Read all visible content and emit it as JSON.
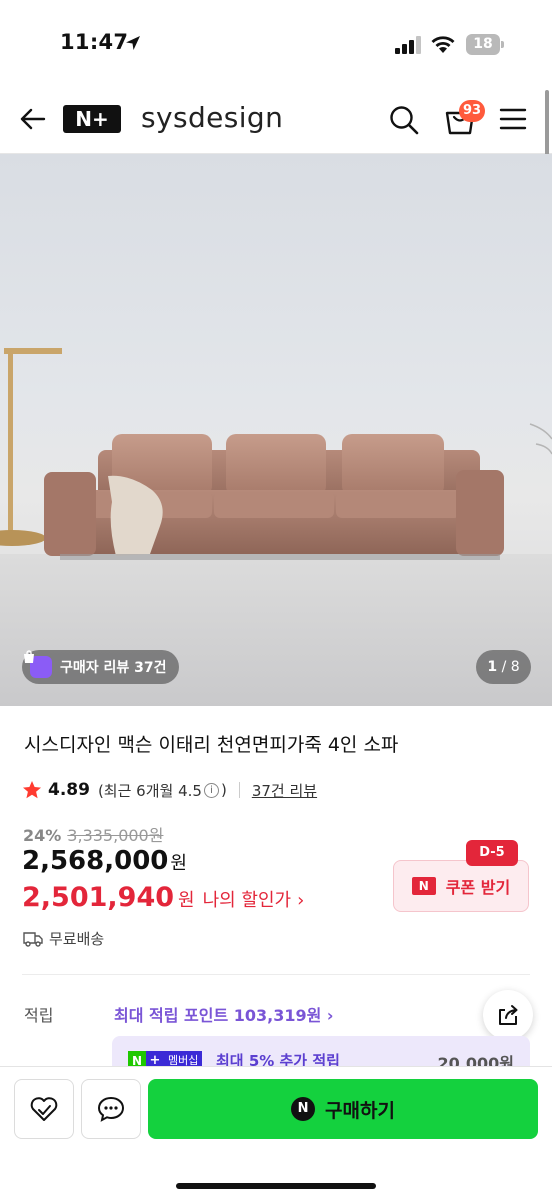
{
  "status_bar": {
    "time": "11:47",
    "battery": "18"
  },
  "header": {
    "logo_text": "N+",
    "brand": "sysdesign",
    "cart_count": "93"
  },
  "hero": {
    "review_chip": "구매자 리뷰 37건",
    "image_index": "1",
    "image_total": "/ 8"
  },
  "product": {
    "title": "시스디자인 맥슨 이태리 천연면피가죽 4인 소파",
    "rating": "4.89",
    "rating_detail_prefix": "(최근 6개월 4.5",
    "rating_detail_suffix": ")",
    "review_count": "37건 리뷰",
    "discount_pct": "24%",
    "original_price": "3,335,000원",
    "price": "2,568,000",
    "price_unit": "원",
    "my_price": "2,501,940",
    "my_price_unit": "원",
    "my_price_label": "나의 할인가",
    "shipping": "무료배송"
  },
  "coupon": {
    "dday": "D-5",
    "n_label": "N",
    "label": "쿠폰 받기"
  },
  "points": {
    "label": "적립",
    "value": "최대 적립 포인트 103,319원 ›",
    "membership_tag_label": "멤버십",
    "membership_text": "최대 5% 추가 적립",
    "membership_amount": "20,000원"
  },
  "bottom_bar": {
    "buy_label": "구매하기",
    "buy_icon": "N"
  },
  "colors": {
    "accent_red": "#e3263a",
    "naver_green": "#14d13e",
    "points_purple": "#7a55d6"
  }
}
